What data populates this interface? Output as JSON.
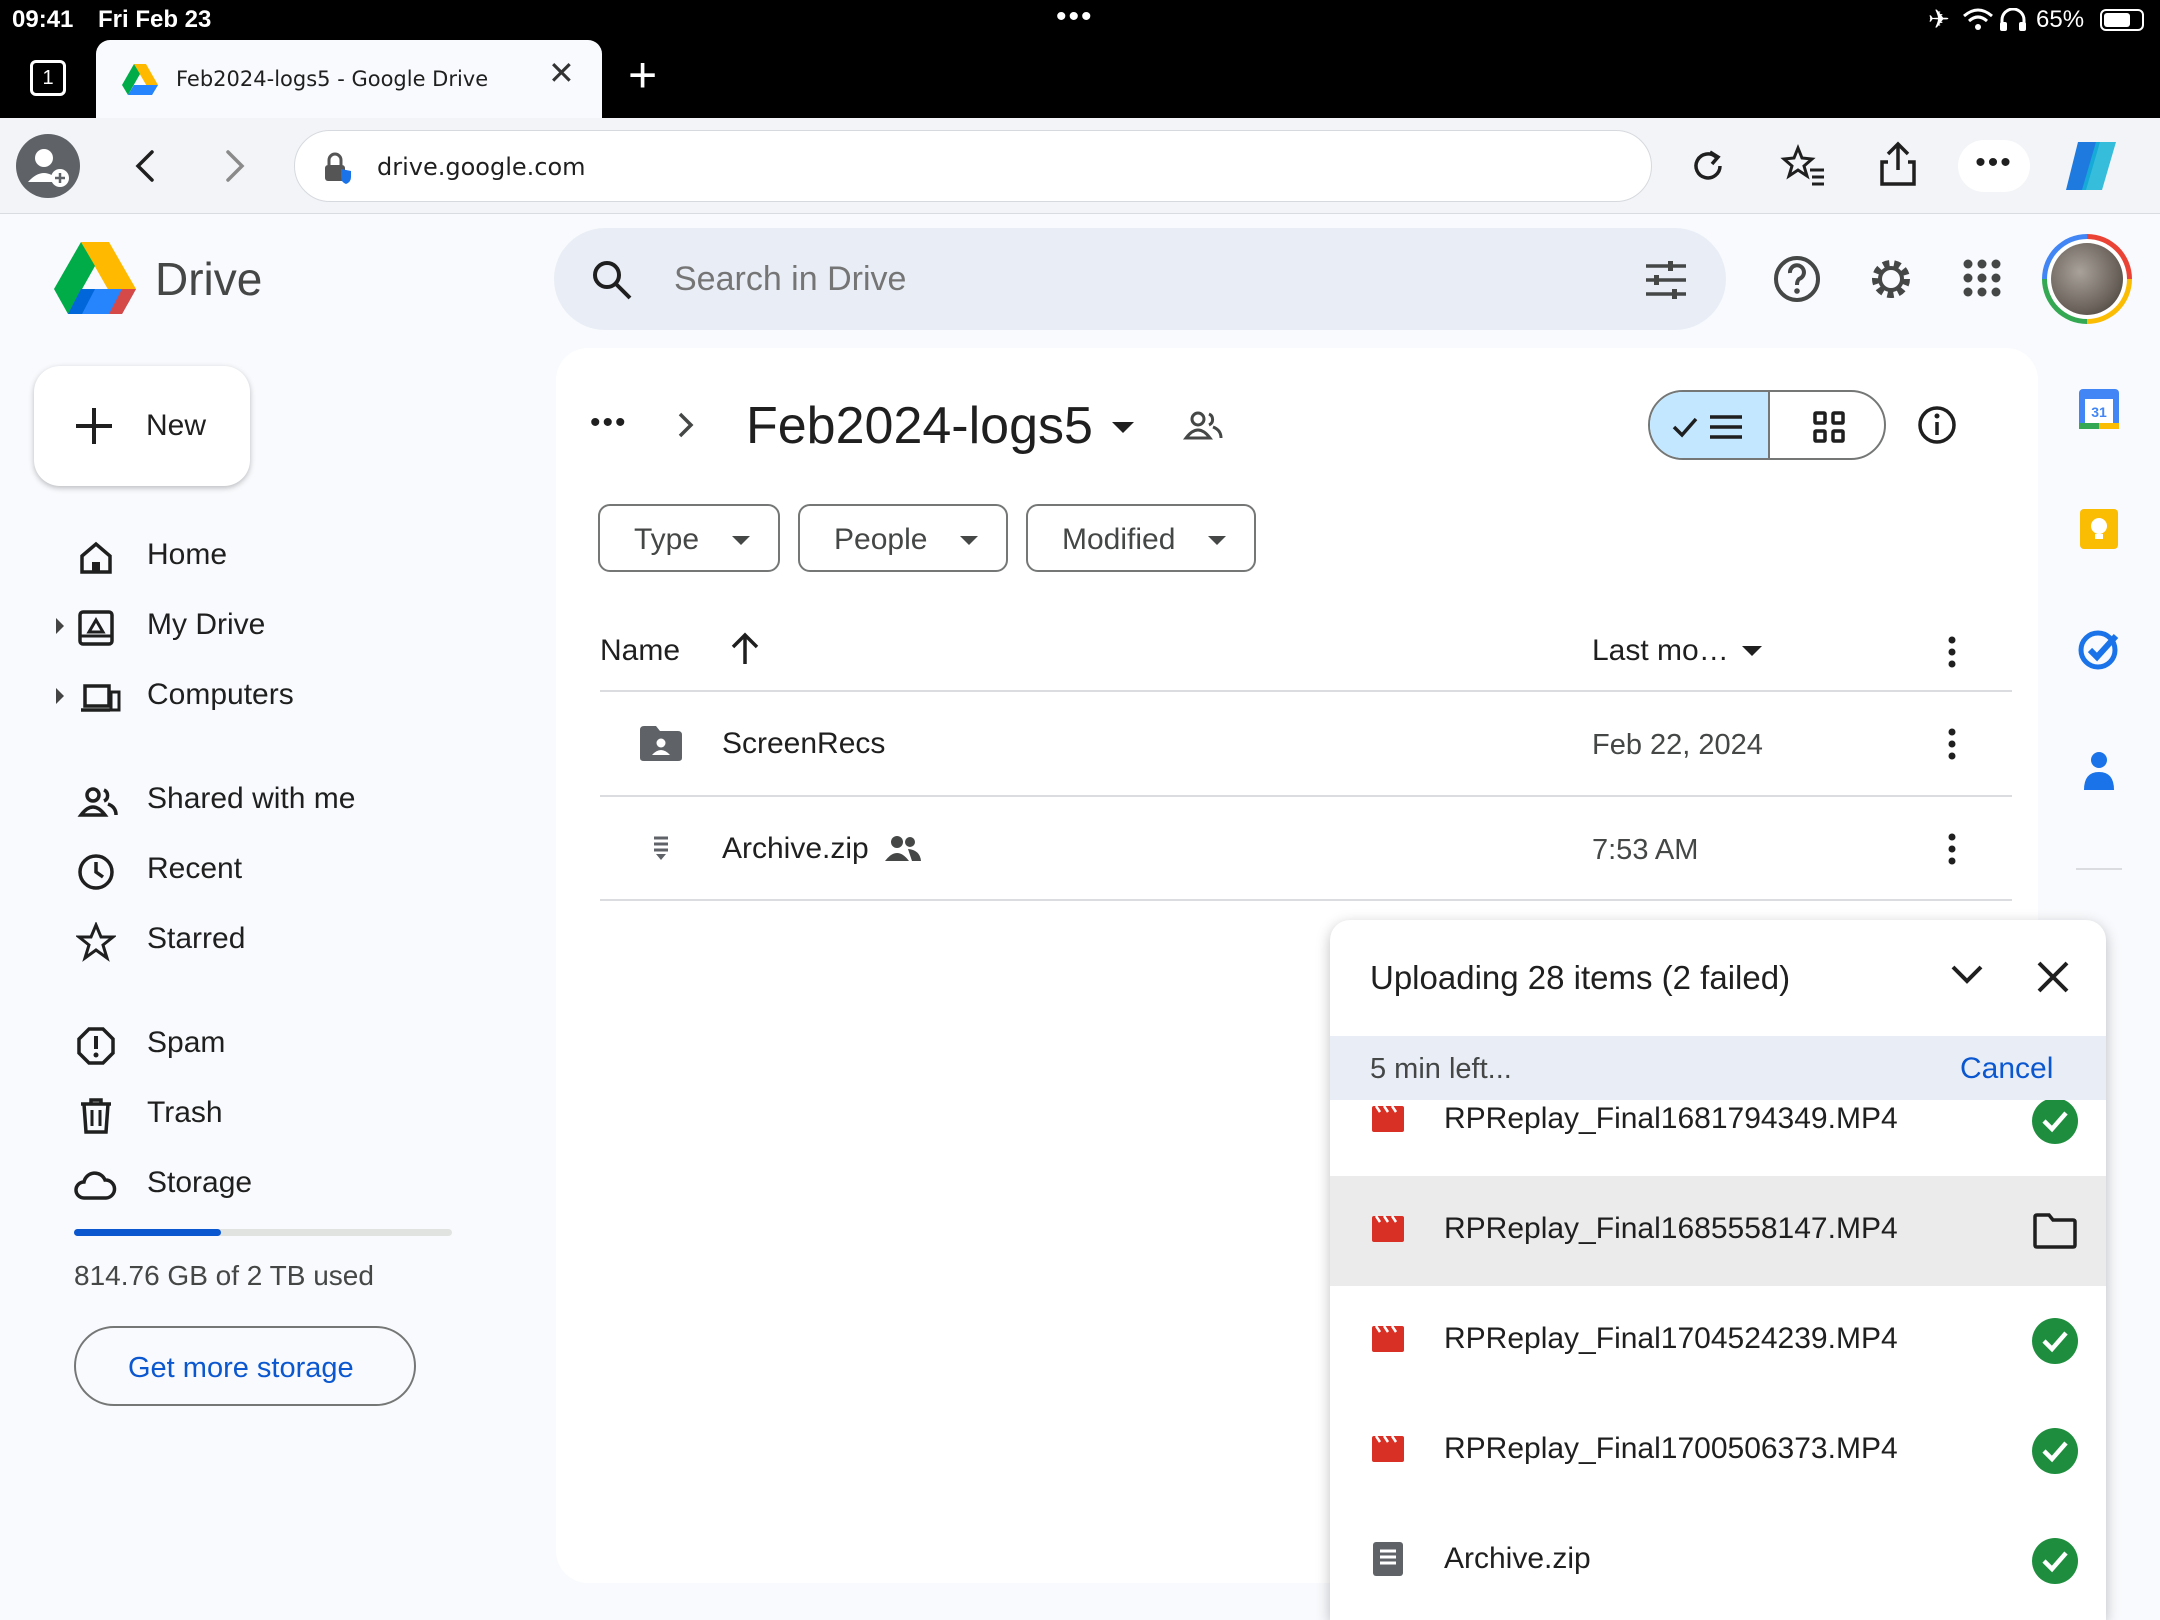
{
  "status_bar": {
    "time": "09:41",
    "date": "Fri Feb 23",
    "battery": "65%"
  },
  "browser": {
    "tab_count": "1",
    "tab_title": "Feb2024-logs5 - Google Drive",
    "url": "drive.google.com"
  },
  "app": {
    "name": "Drive"
  },
  "search": {
    "placeholder": "Search in Drive"
  },
  "sidebar": {
    "new_label": "New",
    "items": [
      {
        "label": "Home"
      },
      {
        "label": "My Drive"
      },
      {
        "label": "Computers"
      },
      {
        "label": "Shared with me"
      },
      {
        "label": "Recent"
      },
      {
        "label": "Starred"
      },
      {
        "label": "Spam"
      },
      {
        "label": "Trash"
      },
      {
        "label": "Storage"
      }
    ],
    "storage_text": "814.76 GB of 2 TB used",
    "storage_used_fraction": 0.39,
    "get_storage_label": "Get more storage"
  },
  "folder": {
    "title": "Feb2024-logs5"
  },
  "filters": {
    "type": "Type",
    "people": "People",
    "modified": "Modified"
  },
  "table": {
    "col_name": "Name",
    "col_modified": "Last mo…",
    "rows": [
      {
        "name": "ScreenRecs",
        "modified": "Feb 22, 2024"
      },
      {
        "name": "Archive.zip",
        "modified": "7:53 AM"
      }
    ]
  },
  "upload": {
    "title": "Uploading 28 items (2 failed)",
    "time_left": "5 min left...",
    "cancel_label": "Cancel",
    "items": [
      {
        "name": "RPReplay_Final1681794349.MP4",
        "status": "done"
      },
      {
        "name": "RPReplay_Final1685558147.MP4",
        "status": "hover-folder"
      },
      {
        "name": "RPReplay_Final1704524239.MP4",
        "status": "done"
      },
      {
        "name": "RPReplay_Final1700506373.MP4",
        "status": "done"
      },
      {
        "name": "Archive.zip",
        "status": "done"
      }
    ]
  },
  "colors": {
    "accent": "#0b57d0",
    "success": "#1e8e3e",
    "video_red": "#d93025"
  }
}
